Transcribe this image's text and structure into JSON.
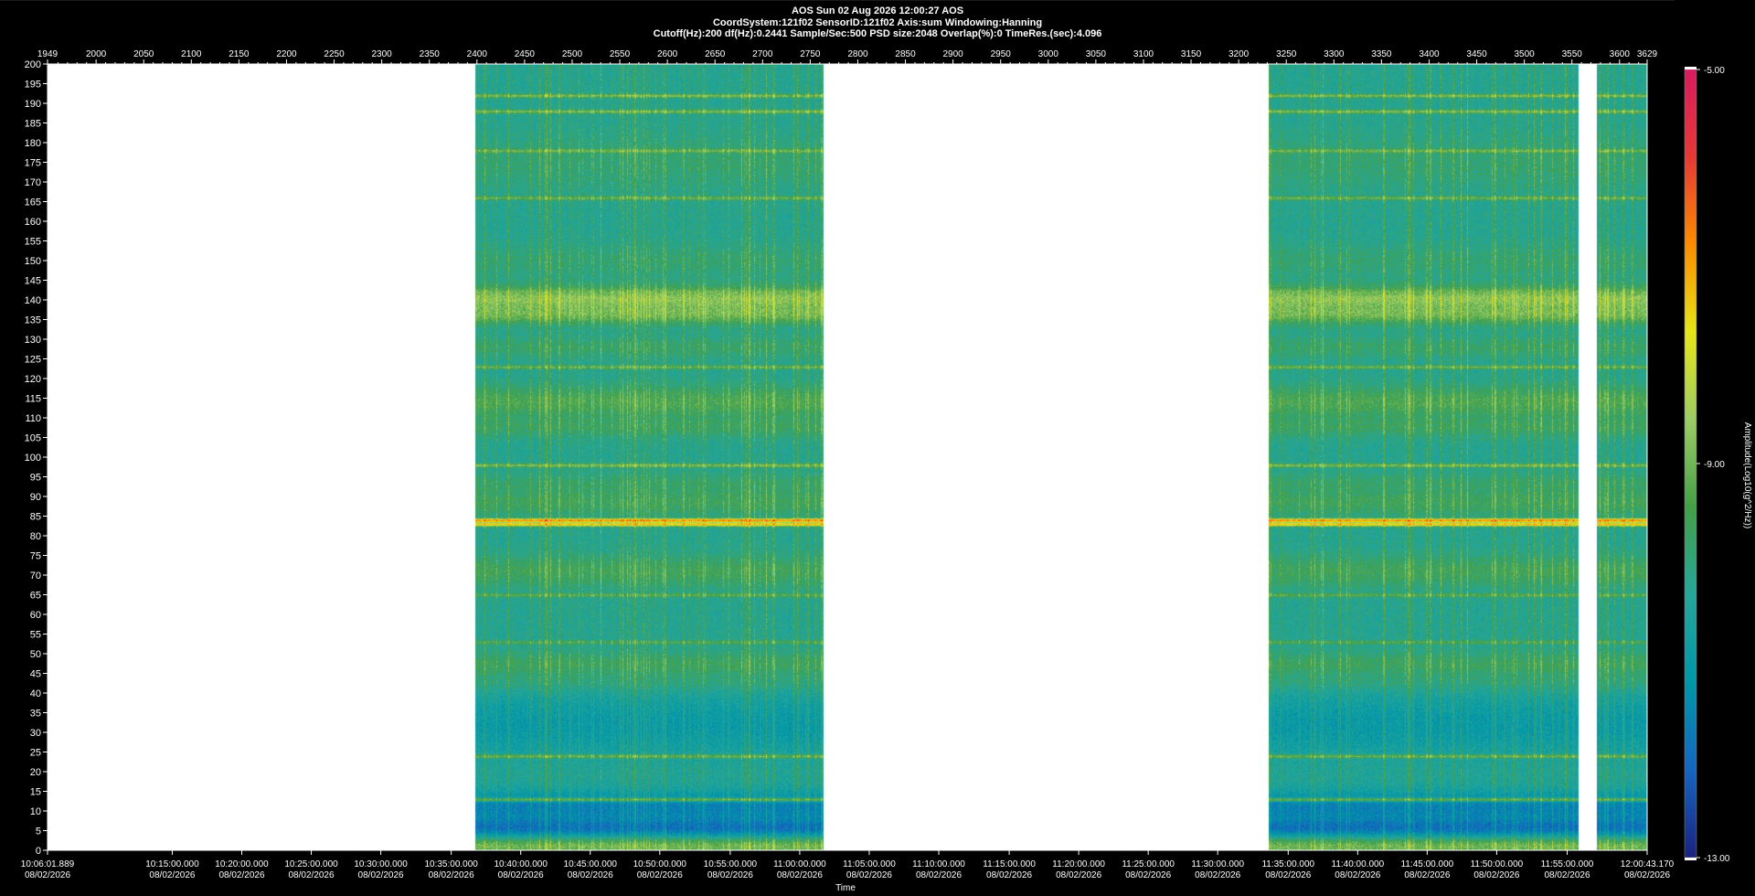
{
  "header": {
    "line1": "AOS  Sun 02 Aug 2026 12:00:27  AOS",
    "line2": "CoordSystem:121f02    SensorID:121f02    Axis:sum    Windowing:Hanning",
    "line3": "Cutoff(Hz):200      df(Hz):0.2441      Sample/Sec:500      PSD size:2048      Overlap(%):0      TimeRes.(sec):4.096"
  },
  "chart_data": {
    "type": "heatmap",
    "xlabel": "Time",
    "colorbar_label": "Amplitude(Log10(g^2/Hz))",
    "colorbar_ticks": [
      "-5.00",
      "-9.00",
      "-13.00"
    ],
    "colorbar_range": [
      -13,
      -5
    ],
    "colormap": [
      "#1a237e",
      "#1565c0",
      "#0097a7",
      "#26a69a",
      "#43a047",
      "#9ccc65",
      "#e6e619",
      "#fb8c00",
      "#e53935",
      "#d81b60"
    ],
    "top_axis": {
      "range": [
        1949,
        3629
      ],
      "ticks": [
        1949,
        2000,
        2050,
        2100,
        2150,
        2200,
        2250,
        2300,
        2350,
        2400,
        2450,
        2500,
        2550,
        2600,
        2650,
        2700,
        2750,
        2800,
        2850,
        2900,
        2950,
        3000,
        3050,
        3100,
        3150,
        3200,
        3250,
        3300,
        3350,
        3400,
        3450,
        3500,
        3550,
        3600,
        3629
      ]
    },
    "y_axis": {
      "range": [
        0,
        200
      ],
      "ticks": [
        0,
        5,
        10,
        15,
        20,
        25,
        30,
        35,
        40,
        45,
        50,
        55,
        60,
        65,
        70,
        75,
        80,
        85,
        90,
        95,
        100,
        105,
        110,
        115,
        120,
        125,
        130,
        135,
        140,
        145,
        150,
        155,
        160,
        165,
        170,
        175,
        180,
        185,
        190,
        195,
        200
      ]
    },
    "time_ticks": [
      {
        "pos": 1949,
        "time": "10:06:01.889",
        "date": "08/02/2026"
      },
      {
        "pos": 2080,
        "time": "10:15:00.000",
        "date": "08/02/2026"
      },
      {
        "pos": 2153,
        "time": "10:20:00.000",
        "date": "08/02/2026"
      },
      {
        "pos": 2226,
        "time": "10:25:00.000",
        "date": "08/02/2026"
      },
      {
        "pos": 2299,
        "time": "10:30:00.000",
        "date": "08/02/2026"
      },
      {
        "pos": 2373,
        "time": "10:35:00.000",
        "date": "08/02/2026"
      },
      {
        "pos": 2446,
        "time": "10:40:00.000",
        "date": "08/02/2026"
      },
      {
        "pos": 2519,
        "time": "10:45:00.000",
        "date": "08/02/2026"
      },
      {
        "pos": 2592,
        "time": "10:50:00.000",
        "date": "08/02/2026"
      },
      {
        "pos": 2666,
        "time": "10:55:00.000",
        "date": "08/02/2026"
      },
      {
        "pos": 2739,
        "time": "11:00:00.000",
        "date": "08/02/2026"
      },
      {
        "pos": 2812,
        "time": "11:05:00.000",
        "date": "08/02/2026"
      },
      {
        "pos": 2885,
        "time": "11:10:00.000",
        "date": "08/02/2026"
      },
      {
        "pos": 2959,
        "time": "11:15:00.000",
        "date": "08/02/2026"
      },
      {
        "pos": 3032,
        "time": "11:20:00.000",
        "date": "08/02/2026"
      },
      {
        "pos": 3105,
        "time": "11:25:00.000",
        "date": "08/02/2026"
      },
      {
        "pos": 3178,
        "time": "11:30:00.000",
        "date": "08/02/2026"
      },
      {
        "pos": 3252,
        "time": "11:35:00.000",
        "date": "08/02/2026"
      },
      {
        "pos": 3325,
        "time": "11:40:00.000",
        "date": "08/02/2026"
      },
      {
        "pos": 3398,
        "time": "11:45:00.000",
        "date": "08/02/2026"
      },
      {
        "pos": 3471,
        "time": "11:50:00.000",
        "date": "08/02/2026"
      },
      {
        "pos": 3545,
        "time": "11:55:00.000",
        "date": "08/02/2026"
      },
      {
        "pos": 3629,
        "time": "12:00:43.170",
        "date": "08/02/2026"
      }
    ],
    "data_segments": [
      [
        2398,
        2764
      ],
      [
        3232,
        3557
      ],
      [
        3576,
        3629
      ]
    ],
    "gap_fill": "#ffffff",
    "base_level": -10.3,
    "freq_bands": [
      {
        "f": 140,
        "w": 2.5,
        "amp": -8.6
      },
      {
        "f": 137,
        "w": 2,
        "amp": -8.9
      },
      {
        "f": 114,
        "w": 3,
        "amp": -9.4
      },
      {
        "f": 108,
        "w": 2,
        "amp": -9.7
      },
      {
        "f": 128,
        "w": 2,
        "amp": -9.8
      },
      {
        "f": 150,
        "w": 3,
        "amp": -9.9
      },
      {
        "f": 175,
        "w": 5,
        "amp": -9.9
      },
      {
        "f": 89,
        "w": 3,
        "amp": -9.6
      },
      {
        "f": 93,
        "w": 2,
        "amp": -9.8
      },
      {
        "f": 71,
        "w": 3,
        "amp": -9.6
      },
      {
        "f": 47,
        "w": 2.5,
        "amp": -9.6
      },
      {
        "f": 43,
        "w": 2,
        "amp": -9.8
      },
      {
        "f": 32,
        "w": 6,
        "amp": -11.0
      },
      {
        "f": 11,
        "w": 3,
        "amp": -11.6
      },
      {
        "f": 6,
        "w": 2,
        "amp": -11.9
      },
      {
        "f": 1,
        "w": 1.5,
        "amp": -9.0
      }
    ],
    "tone_lines": [
      {
        "f": 192,
        "amp": -8.9
      },
      {
        "f": 188,
        "amp": -8.9
      },
      {
        "f": 178,
        "amp": -9.0
      },
      {
        "f": 166,
        "amp": -9.1
      },
      {
        "f": 142,
        "amp": -9.0
      },
      {
        "f": 123,
        "amp": -9.1
      },
      {
        "f": 98,
        "amp": -8.9
      },
      {
        "f": 84,
        "amp": -6.8
      },
      {
        "f": 83,
        "amp": -7.4
      },
      {
        "f": 65,
        "amp": -9.3
      },
      {
        "f": 53,
        "amp": -9.4
      },
      {
        "f": 24,
        "amp": -9.1
      },
      {
        "f": 13,
        "amp": -9.2
      }
    ]
  }
}
